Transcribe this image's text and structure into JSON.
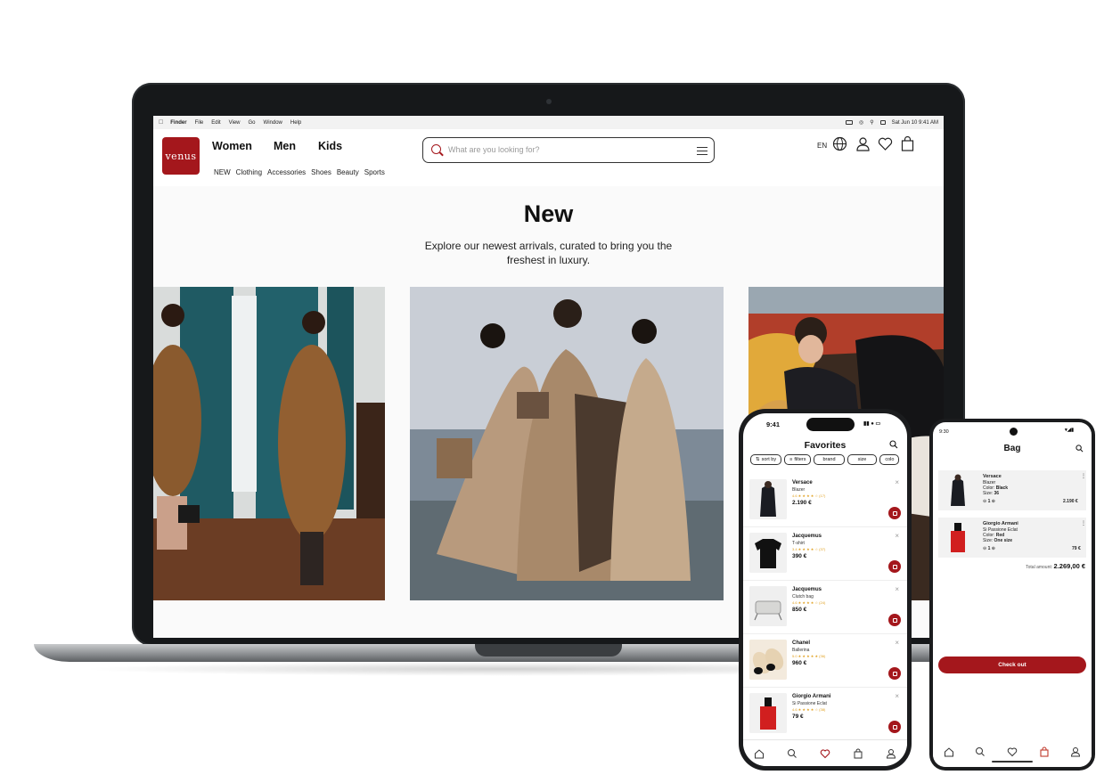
{
  "menubar": {
    "items": [
      "Finder",
      "File",
      "Edit",
      "View",
      "Go",
      "Window",
      "Help"
    ],
    "datetime": "Sat Jun 10  9:41 AM"
  },
  "site": {
    "logo": "venus",
    "main_categories": [
      "Women",
      "Men",
      "Kids"
    ],
    "sub_nav": [
      "NEW",
      "Clothing",
      "Accessories",
      "Shoes",
      "Beauty",
      "Sports"
    ],
    "search_placeholder": "What are you looking for?",
    "language": "EN",
    "hero_title": "New",
    "hero_subtitle": "Explore our newest arrivals, curated to bring you the freshest in luxury."
  },
  "iphone": {
    "time": "9:41",
    "title": "Favorites",
    "chips": [
      "sort by",
      "filters",
      "brand",
      "size",
      "colo"
    ],
    "items": [
      {
        "brand": "Versace",
        "name": "Blazer",
        "rating": "4.6 ★ ★ ★ ★ ☆ (17)",
        "price": "2.190 €"
      },
      {
        "brand": "Jacquemus",
        "name": "T-shirt",
        "rating": "3.4 ★ ★ ★ ★ ☆ (37)",
        "price": "390 €"
      },
      {
        "brand": "Jacquemus",
        "name": "Clutch bag",
        "rating": "4.6 ★ ★ ★ ★ ☆ (24)",
        "price": "850 €"
      },
      {
        "brand": "Chanel",
        "name": "Ballerina",
        "rating": "5.0 ★ ★ ★ ★ ★ (36)",
        "price": "960 €"
      },
      {
        "brand": "Giorgio Armani",
        "name": "Si Passione Eclat",
        "rating": "4.6 ★ ★ ★ ★ ☆ (38)",
        "price": "79 €"
      }
    ]
  },
  "android": {
    "time": "9:30",
    "title": "Bag",
    "items": [
      {
        "brand": "Versace",
        "name": "Blazer",
        "color_label": "Color:",
        "color": "Black",
        "size_label": "Size:",
        "size": "36",
        "qty": "1",
        "price": "2.190 €"
      },
      {
        "brand": "Giorgio Armani",
        "name": "Si Passione Eclat",
        "color_label": "Color:",
        "color": "Red",
        "size_label": "Size:",
        "size": "One size",
        "qty": "1",
        "price": "79 €"
      }
    ],
    "total_label": "Total amount:",
    "total": "2.269,00 €",
    "checkout": "Check out"
  },
  "colors": {
    "brand_red": "#a4171c",
    "star": "#e0a020"
  }
}
